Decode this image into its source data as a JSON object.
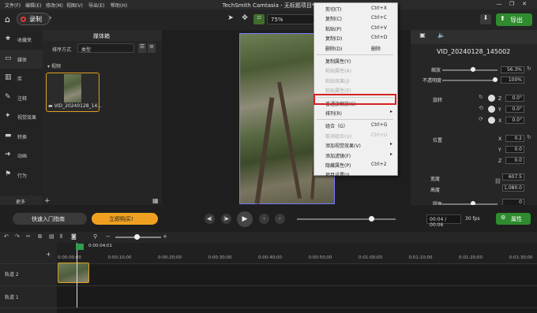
{
  "menubar": {
    "items": [
      "文件(F)",
      "编辑(E)",
      "修改(M)",
      "视图(V)",
      "导出(E)",
      "帮助(H)"
    ],
    "title": "TechSmith Camtasia - 无标题项目*"
  },
  "toolbar": {
    "record": "录制",
    "zoom": "75%",
    "export": "导出"
  },
  "leftnav": {
    "items": [
      {
        "icon": "star-icon",
        "label": "收藏夹"
      },
      {
        "icon": "media-icon",
        "label": "媒体"
      },
      {
        "icon": "library-icon",
        "label": "库"
      },
      {
        "icon": "annotation-icon",
        "label": "注释"
      },
      {
        "icon": "effects-icon",
        "label": "视觉效果"
      },
      {
        "icon": "transition-icon",
        "label": "转换"
      },
      {
        "icon": "animation-icon",
        "label": "动画"
      },
      {
        "icon": "behavior-icon",
        "label": "行为"
      }
    ],
    "more": "更多"
  },
  "media": {
    "title": "媒体箱",
    "sort_label": "排序方式",
    "sort_value": "类型",
    "section": "视频",
    "clip_name": "VID_20240128_14..."
  },
  "context_menu": {
    "items": [
      {
        "label": "剪切(T)",
        "key": "Ctrl+X",
        "disabled": false
      },
      {
        "label": "复制(C)",
        "key": "Ctrl+C",
        "disabled": false
      },
      {
        "label": "粘贴(P)",
        "key": "Ctrl+V",
        "disabled": false
      },
      {
        "label": "复制(D)",
        "key": "Ctrl+D",
        "disabled": false
      },
      {
        "label": "删除(D)",
        "key": "删除",
        "disabled": false
      },
      {
        "sep": true
      },
      {
        "label": "复制属性(Y)",
        "key": "",
        "disabled": false
      },
      {
        "label": "粘贴属性(A)",
        "key": "",
        "disabled": true
      },
      {
        "label": "粘贴效果(J)",
        "key": "",
        "disabled": true
      },
      {
        "label": "粘贴属性(E)",
        "key": "",
        "disabled": true
      },
      {
        "sep": true
      },
      {
        "label": "普通放缩放(S)",
        "key": "",
        "disabled": false,
        "highlight": true
      },
      {
        "label": "排列(R)",
        "key": "",
        "disabled": false,
        "submenu": true
      },
      {
        "sep": true
      },
      {
        "label": "组合（G）",
        "key": "Ctrl+G",
        "disabled": false
      },
      {
        "label": "取消组合(U)",
        "key": "Ctrl+U",
        "disabled": true
      },
      {
        "label": "添加视觉效果(V)",
        "key": "",
        "disabled": false,
        "submenu": true
      },
      {
        "label": "添加滤镜(F)",
        "key": "",
        "disabled": false,
        "submenu": true
      },
      {
        "label": "隐藏属性(P)",
        "key": "Ctrl+2",
        "disabled": false
      },
      {
        "label": "项目设置(J)...",
        "key": "",
        "disabled": false
      }
    ]
  },
  "properties": {
    "clip_name": "VID_20240128_145002",
    "scale_label": "缩放",
    "scale": "56.3%",
    "opacity_label": "不透明度",
    "opacity": "100%",
    "rotation_label": "旋转",
    "rot_z": "0.0°",
    "rot_y": "0.0°",
    "rot_x": "0.0°",
    "z_label": "Z",
    "y_label": "Y",
    "x_label": "X",
    "position_label": "位置",
    "pos_x": "0.2",
    "pos_y": "0.0",
    "pos_z": "0.0",
    "width_label": "宽度",
    "width": "607.5",
    "height_label": "高度",
    "height": "1,080.0",
    "corner_label": "圆角",
    "corner": "0",
    "scale_fraction": 0.563,
    "opacity_fraction": 1.0
  },
  "playback": {
    "guide": "快速入门指南",
    "buy": "立即购买!",
    "time": "00:04 / 00:06",
    "fps": "30 fps",
    "props_button": "属性",
    "progress": 0.75
  },
  "timeline": {
    "playhead": "0:00:04;01",
    "ticks": [
      "0:00:00;00",
      "0:00:10;00",
      "0:00:20;00",
      "0:00:30;00",
      "0:00:40;00",
      "0:00:50;00",
      "0:01:00;00",
      "0:01:10;00",
      "0:01:20;00",
      "0:01:30;00"
    ],
    "track2": "轨道 2",
    "track1": "轨道 1"
  }
}
